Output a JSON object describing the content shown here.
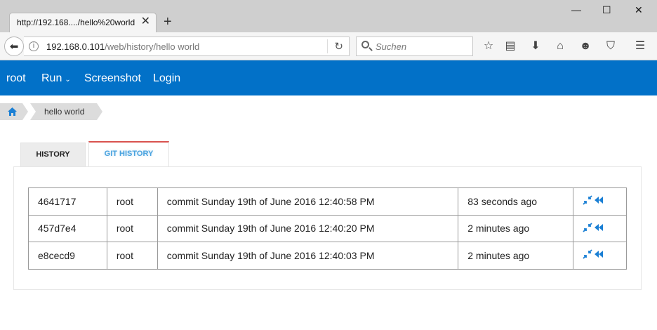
{
  "browser": {
    "tab_title": "http://192.168..../hello%20world",
    "new_tab_label": "+",
    "url_host": "192.168.0.101",
    "url_path": "/web/history/hello world",
    "search_placeholder": "Suchen",
    "window_controls": {
      "minimize": "—",
      "maximize": "☐",
      "close": "✕"
    }
  },
  "app_nav": {
    "items": [
      {
        "label": "root"
      },
      {
        "label": "Run",
        "caret": "⌄"
      },
      {
        "label": "Screenshot"
      },
      {
        "label": "Login"
      }
    ]
  },
  "breadcrumb": {
    "home_icon": "home-icon",
    "current": "hello world"
  },
  "tabs": [
    {
      "label": "HISTORY",
      "active": false
    },
    {
      "label": "GIT HISTORY",
      "active": true
    }
  ],
  "commits": [
    {
      "hash": "4641717",
      "user": "root",
      "message": "commit Sunday 19th of June 2016 12:40:58 PM",
      "time": "83 seconds ago"
    },
    {
      "hash": "457d7e4",
      "user": "root",
      "message": "commit Sunday 19th of June 2016 12:40:20 PM",
      "time": "2 minutes ago"
    },
    {
      "hash": "e8cecd9",
      "user": "root",
      "message": "commit Sunday 19th of June 2016 12:40:03 PM",
      "time": "2 minutes ago"
    }
  ],
  "colors": {
    "nav_bg": "#0271c8",
    "active_tab_accent": "#d9534f",
    "active_tab_text": "#4aa3df",
    "action_icon": "#1a7fd4"
  }
}
